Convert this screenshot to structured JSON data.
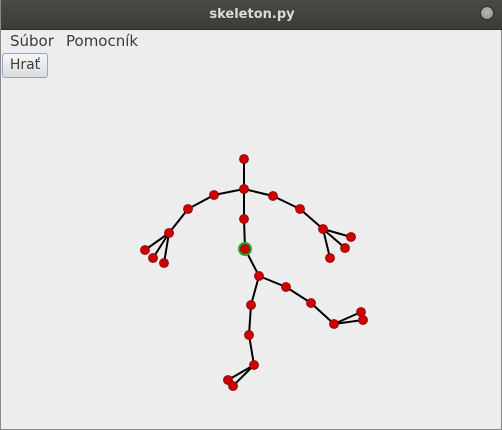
{
  "window": {
    "title": "skeleton.py"
  },
  "menu": {
    "items": [
      "Súbor",
      "Pomocník"
    ]
  },
  "toolbar": {
    "play_label": "Hrať"
  },
  "colors": {
    "joint": "#cc0000",
    "joint_outline": "#8a0000",
    "selected_ring": "#2ea829",
    "bone": "#000000",
    "background": "#ededed"
  },
  "icons": {
    "close": "close-icon"
  }
}
